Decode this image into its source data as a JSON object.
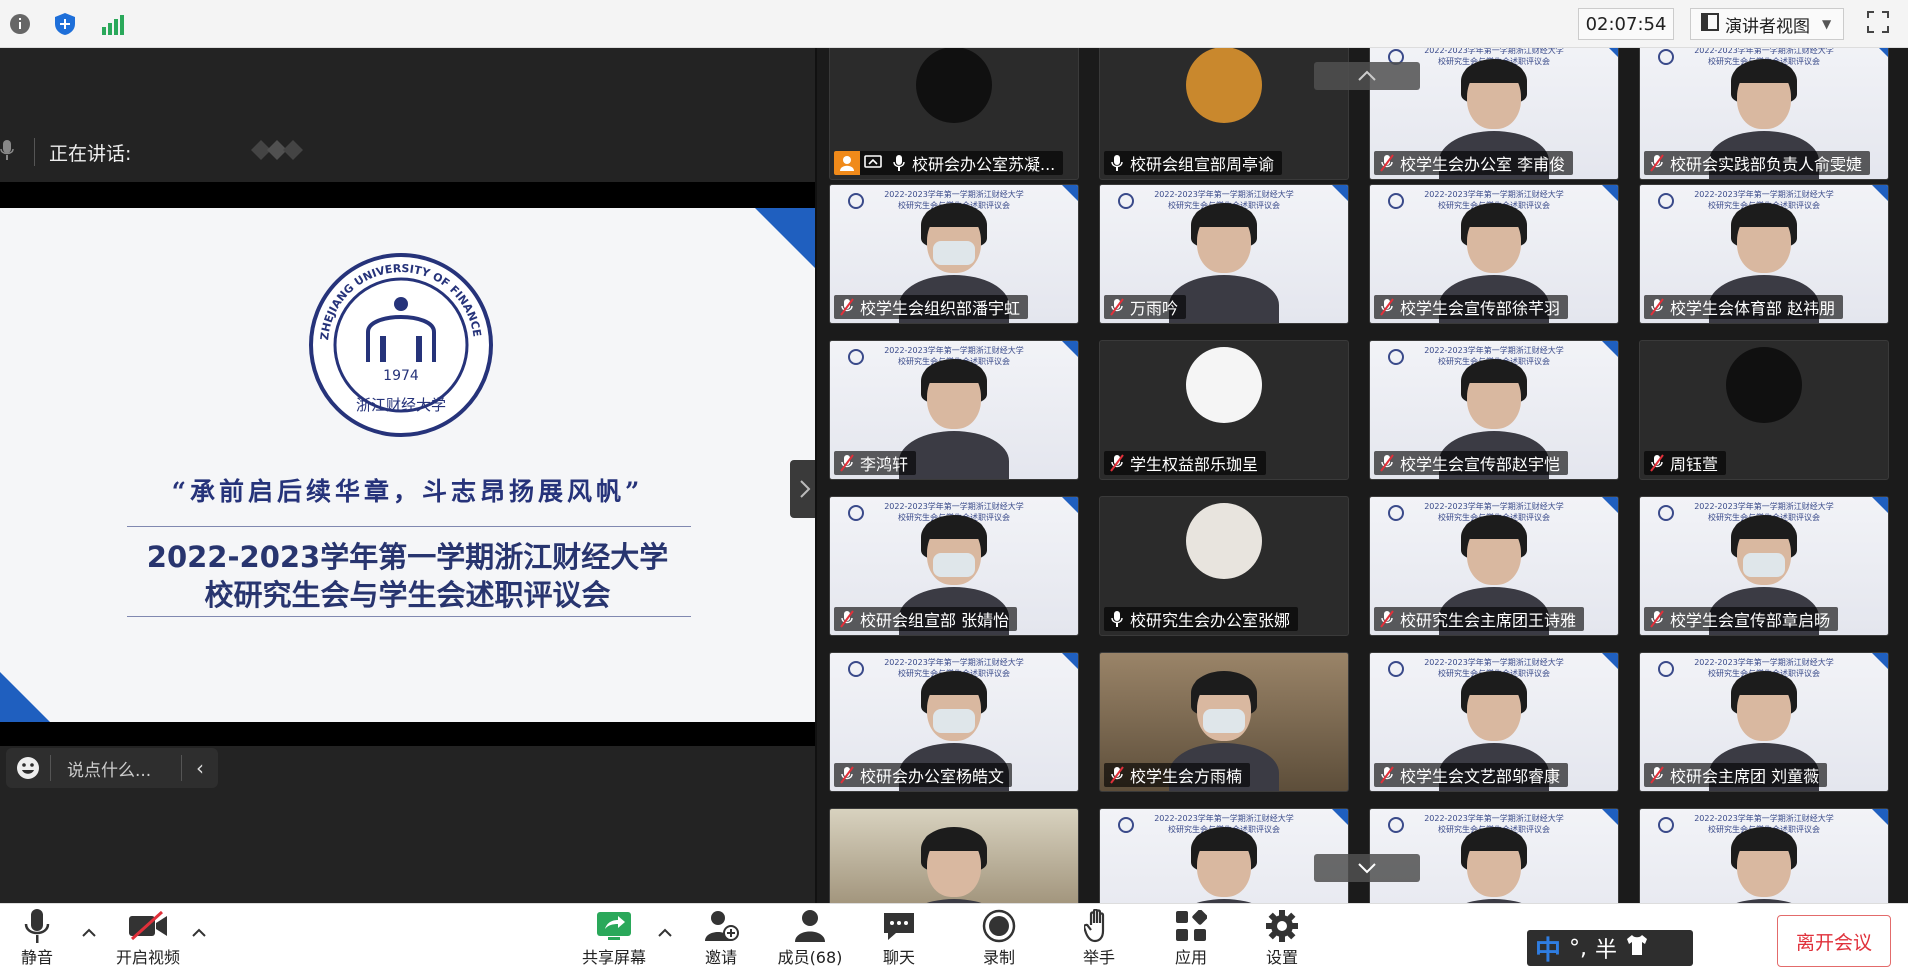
{
  "topbar": {
    "timer": "02:07:54",
    "view_label": "演讲者视图"
  },
  "speaking": {
    "label": "正在讲话:"
  },
  "slide": {
    "logo_text": "ZHEJIANG UNIVERSITY OF FINANCE & ECONOMICS",
    "logo_year": "1974",
    "logo_chinese": "浙江财经大学",
    "motto": "“承前启后续华章，斗志昂扬展风帆”",
    "title_line1": "2022-2023学年第一学期浙江财经大学",
    "title_line2": "校研究生会与学生会述职评议会"
  },
  "chat": {
    "placeholder": "说点什么..."
  },
  "tile_header": [
    "2022-2023学年第一学期浙江财经大学",
    "校研究生会与学生会述职评议会"
  ],
  "participants": [
    {
      "name": "校研会办公室苏凝...",
      "kind": "avatar",
      "mic": "on",
      "host": true
    },
    {
      "name": "校研会组宣部周亭谕",
      "kind": "avatar",
      "mic": "on"
    },
    {
      "name": "校学生会办公室 李甫俊",
      "kind": "video",
      "mic": "off"
    },
    {
      "name": "校研会实践部负责人俞雯婕",
      "kind": "video",
      "mic": "off"
    },
    {
      "name": "校学生会组织部潘宇虹",
      "kind": "video",
      "mic": "off",
      "mask": true
    },
    {
      "name": "万雨吟",
      "kind": "video",
      "mic": "off"
    },
    {
      "name": "校学生会宣传部徐芊羽",
      "kind": "video",
      "mic": "off"
    },
    {
      "name": "校学生会体育部 赵祎朋",
      "kind": "video",
      "mic": "off"
    },
    {
      "name": "李鸿轩",
      "kind": "video",
      "mic": "off"
    },
    {
      "name": "学生权益部乐珈呈",
      "kind": "avatar",
      "mic": "off"
    },
    {
      "name": "校学生会宣传部赵宇恺",
      "kind": "video",
      "mic": "off"
    },
    {
      "name": "周钰萱",
      "kind": "avatar",
      "mic": "off"
    },
    {
      "name": "校研会组宣部 张婧怡",
      "kind": "video",
      "mic": "off",
      "mask": true
    },
    {
      "name": "校研究生会办公室张娜",
      "kind": "avatar",
      "mic": "on"
    },
    {
      "name": "校研究生会主席团王诗雅",
      "kind": "video",
      "mic": "off"
    },
    {
      "name": "校学生会宣传部章启旸",
      "kind": "video",
      "mic": "off",
      "mask": true
    },
    {
      "name": "校研会办公室杨皓文",
      "kind": "video",
      "mic": "off",
      "mask": true
    },
    {
      "name": "校学生会方雨楠",
      "kind": "video",
      "mic": "off",
      "mask": true
    },
    {
      "name": "校学生会文艺部邬睿康",
      "kind": "video",
      "mic": "off"
    },
    {
      "name": "校研会主席团 刘童薇",
      "kind": "video",
      "mic": "off"
    },
    {
      "name": "",
      "kind": "video",
      "mic": "none"
    },
    {
      "name": "",
      "kind": "video",
      "mic": "none"
    },
    {
      "name": "",
      "kind": "video",
      "mic": "none"
    },
    {
      "name": "",
      "kind": "video",
      "mic": "none"
    }
  ],
  "toolbar": {
    "mute": "静音",
    "video": "开启视频",
    "share": "共享屏幕",
    "invite": "邀请",
    "members": "成员(68)",
    "chat": "聊天",
    "record": "录制",
    "raise_hand": "举手",
    "apps": "应用",
    "settings": "设置",
    "leave": "离开会议"
  },
  "ime": {
    "lang": "中",
    "punct": "°,",
    "width": "半"
  },
  "colors": {
    "accent": "#1f5fbf",
    "leave_red": "#e0303a",
    "green": "#2aa85a"
  }
}
